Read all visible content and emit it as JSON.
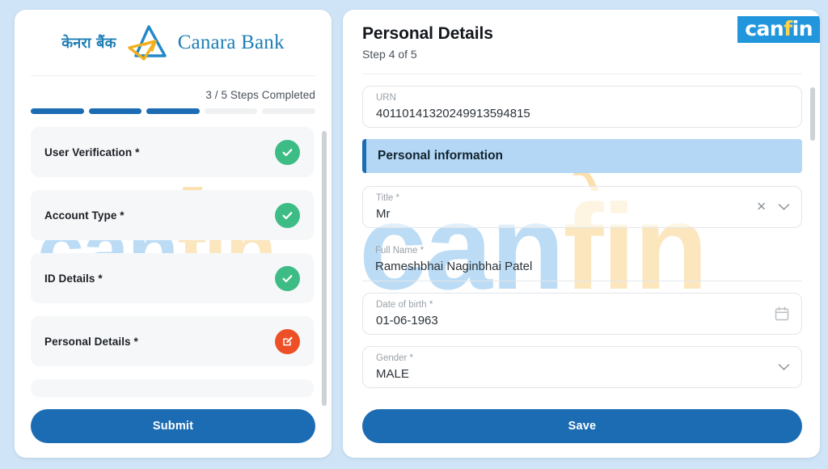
{
  "colors": {
    "page_bg": "#cfe4f7",
    "brand_blue": "#1b6cb3",
    "canara_blue": "#1f7fb5",
    "canara_yellow": "#f2b01e",
    "success_green": "#3ebc86",
    "edit_orange": "#ed5026",
    "canfin_bg": "#2196dd",
    "canfin_f": "#ffd24a",
    "banner_bg": "#b3d7f5",
    "watermark_blue": "#bcdcf5",
    "watermark_yellow": "#fbe6bd"
  },
  "left_panel": {
    "brand": {
      "hindi_name": "केनरा बैंक",
      "english_name": "Canara Bank",
      "logo_icon": "canara-bank-triangle-logo"
    },
    "progress": {
      "label": "3 / 5 Steps Completed",
      "completed": 3,
      "total": 5
    },
    "steps": [
      {
        "label": "User Verification *",
        "status": "completed",
        "icon": "check-icon"
      },
      {
        "label": "Account Type *",
        "status": "completed",
        "icon": "check-icon"
      },
      {
        "label": "ID Details *",
        "status": "completed",
        "icon": "check-icon"
      },
      {
        "label": "Personal Details *",
        "status": "current",
        "icon": "edit-pencil-icon"
      }
    ],
    "submit_label": "Submit",
    "watermark": {
      "part1": "can",
      "part2": "fin",
      "rupee": "₹"
    }
  },
  "right_panel": {
    "title": "Personal Details",
    "step_indicator": "Step 4 of 5",
    "logo": {
      "part1": "can",
      "part2": "f",
      "part3": "in"
    },
    "urn": {
      "label": "URN",
      "value": "40110141320249913594815"
    },
    "section": {
      "heading": "Personal information"
    },
    "fields": [
      {
        "label": "Title *",
        "value": "Mr",
        "icons": [
          "clear-x-icon",
          "chevron-down-icon"
        ]
      },
      {
        "label": "Full Name *",
        "value": "Rameshbhai Naginbhai Patel",
        "icons": []
      },
      {
        "label": "Date of birth *",
        "value": "01-06-1963",
        "icons": [
          "calendar-icon"
        ]
      },
      {
        "label": "Gender *",
        "value": "MALE",
        "icons": [
          "chevron-down-icon"
        ]
      }
    ],
    "save_label": "Save",
    "watermark": {
      "part1": "can",
      "part2": "fin",
      "rupee": "₹"
    }
  }
}
